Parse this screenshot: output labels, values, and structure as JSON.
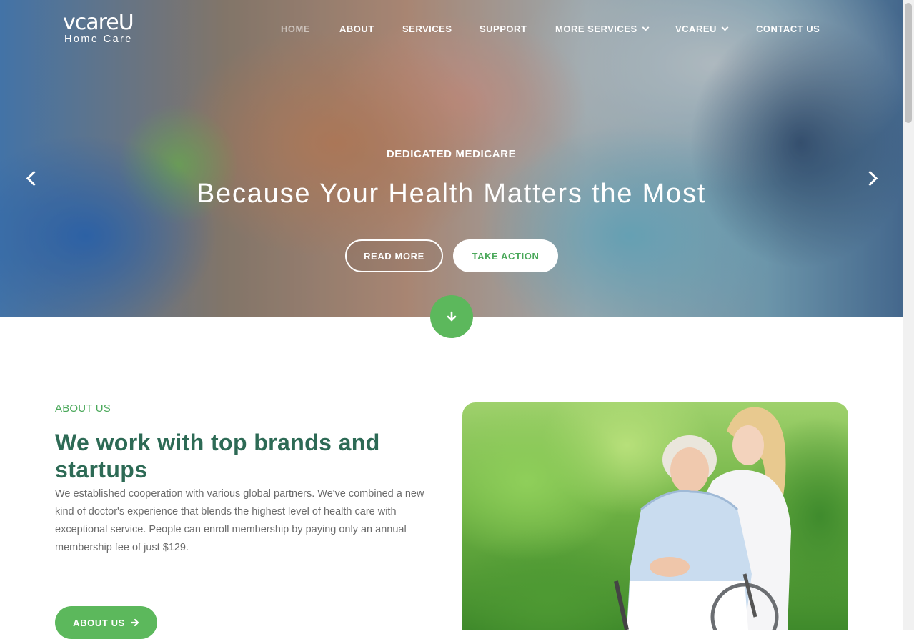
{
  "header": {
    "logo_main": "vcareU",
    "logo_sub": "Home Care",
    "nav": [
      {
        "label": "HOME",
        "active": true,
        "dropdown": false
      },
      {
        "label": "ABOUT",
        "active": false,
        "dropdown": false
      },
      {
        "label": "SERVICES",
        "active": false,
        "dropdown": false
      },
      {
        "label": "SUPPORT",
        "active": false,
        "dropdown": false
      },
      {
        "label": "MORE SERVICES",
        "active": false,
        "dropdown": true
      },
      {
        "label": "VCAREU",
        "active": false,
        "dropdown": true
      },
      {
        "label": "CONTACT US",
        "active": false,
        "dropdown": false
      }
    ]
  },
  "hero": {
    "eyebrow": "DEDICATED MEDICARE",
    "headline": "Because Your Health Matters the Most",
    "read_more": "READ MORE",
    "take_action": "TAKE ACTION",
    "prev_icon": "chevron-left-icon",
    "next_icon": "chevron-right-icon",
    "scroll_icon": "arrow-down-icon"
  },
  "about": {
    "label": "ABOUT US",
    "title": "We work with top brands and startups",
    "text": "We established cooperation with various global partners. We've combined a new kind of doctor's experience that blends the highest level of health care with exceptional service. People can enroll membership by paying only an annual membership fee of just $129.",
    "button": "ABOUT US"
  },
  "colors": {
    "accent_green": "#5cb85c",
    "title_green": "#2d6a55"
  }
}
